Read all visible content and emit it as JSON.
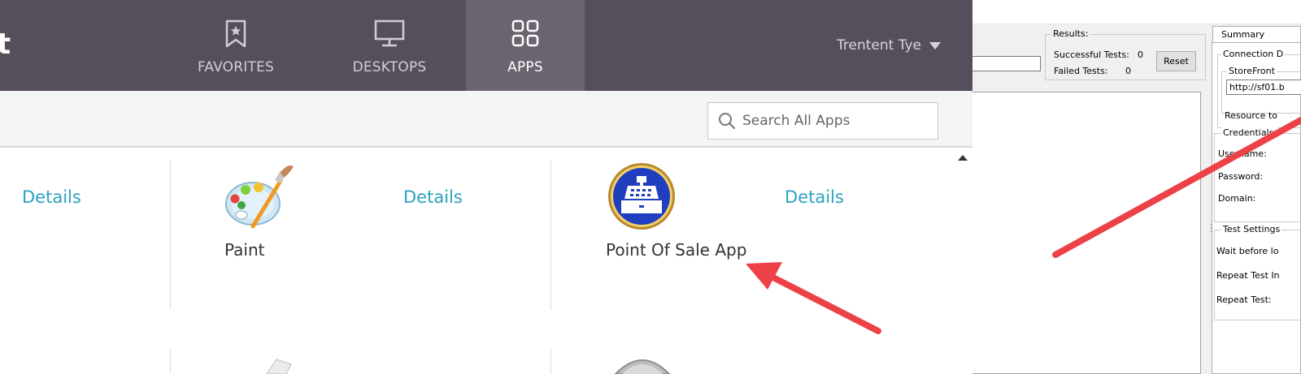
{
  "storefront": {
    "brand_fragment": "t",
    "nav": {
      "favorites": "FAVORITES",
      "desktops": "DESKTOPS",
      "apps": "APPS"
    },
    "user_name": "Trentent Tye",
    "search": {
      "placeholder": "Search All Apps"
    },
    "apps": [
      {
        "details": "Details",
        "name": ""
      },
      {
        "details": "Details",
        "name": "Paint"
      },
      {
        "details": "Details",
        "name": "Point Of Sale App"
      }
    ],
    "colors": {
      "header": "#574e5b",
      "active_tab": "#6c6370",
      "link": "#2aa3c0"
    }
  },
  "tester": {
    "results": {
      "title": "Results:",
      "successful_label": "Successful Tests:",
      "successful_value": "0",
      "failed_label": "Failed Tests:",
      "failed_value": "0"
    },
    "reset_label": "Reset",
    "summary_tab": "Summary",
    "connection": {
      "title": "Connection D",
      "storefront_title": "StoreFront",
      "url_value": "http://sf01.b",
      "resource_label": "Resource to"
    },
    "credentials": {
      "title": "Credentials:",
      "username_label": "Username:",
      "password_label": "Password:",
      "domain_label": "Domain:"
    },
    "test_settings": {
      "title": "Test Settings",
      "wait_label": "Wait before lo",
      "repeat_interval_label": "Repeat Test In",
      "repeat_label": "Repeat Test:"
    }
  },
  "annotation": {
    "arrow_color": "#ec4146"
  }
}
